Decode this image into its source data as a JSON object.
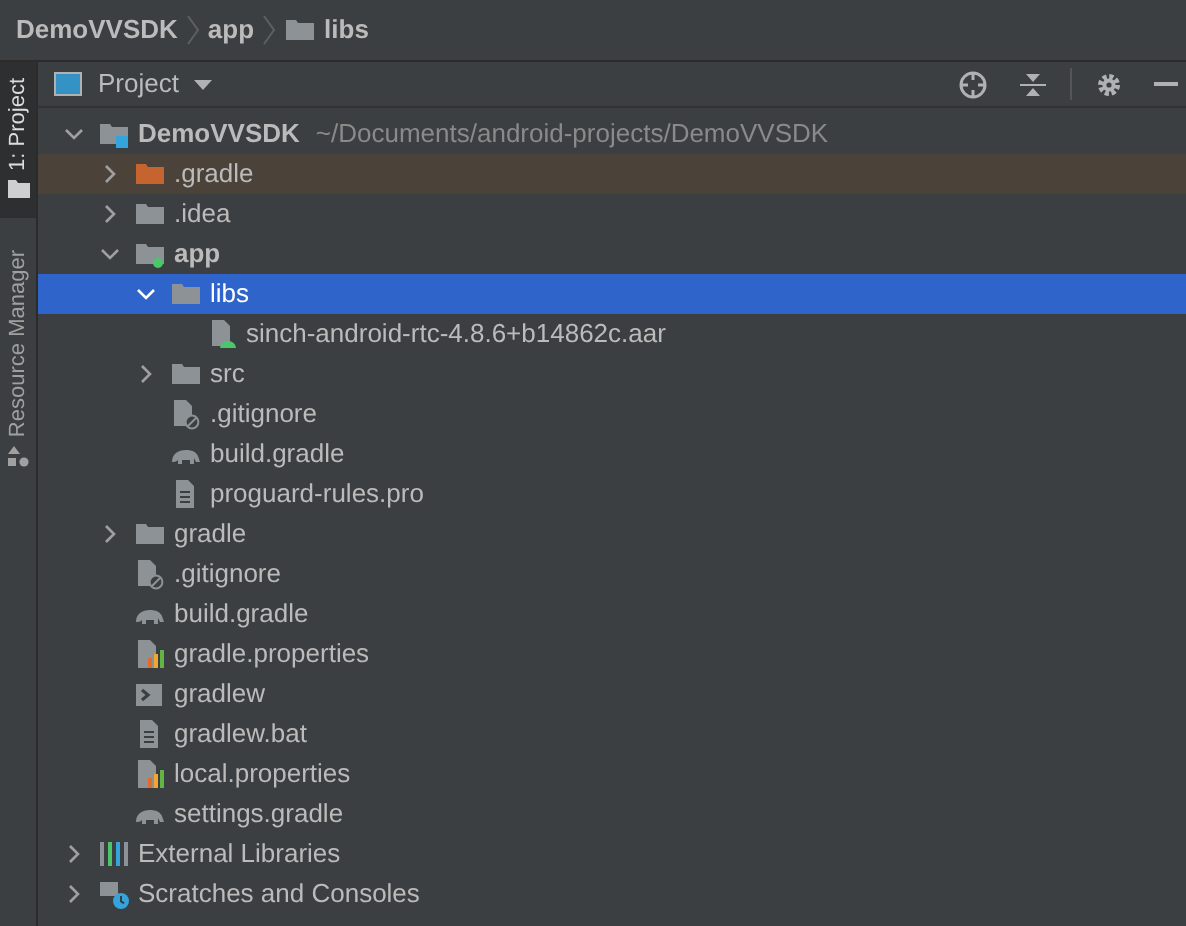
{
  "breadcrumb": [
    "DemoVVSDK",
    "app",
    "libs"
  ],
  "side_tabs": [
    {
      "label": "1: Project",
      "selected": true
    },
    {
      "label": "Resource Manager",
      "selected": false
    }
  ],
  "panel": {
    "title": "Project"
  },
  "tree": [
    {
      "label": "DemoVVSDK",
      "path": "~/Documents/android-projects/DemoVVSDK",
      "kind": "module",
      "expanded": true,
      "selected": false,
      "children": [
        {
          "label": ".gradle",
          "kind": "excluded",
          "expanded": false,
          "selected": false
        },
        {
          "label": ".idea",
          "kind": "folder",
          "expanded": false,
          "selected": false
        },
        {
          "label": "app",
          "kind": "submodule",
          "expanded": true,
          "selected": false,
          "children": [
            {
              "label": "libs",
              "kind": "folder",
              "expanded": true,
              "selected": true,
              "children": [
                {
                  "label": "sinch-android-rtc-4.8.6+b14862c.aar",
                  "kind": "archive",
                  "selected": false
                }
              ]
            },
            {
              "label": "src",
              "kind": "folder",
              "expanded": false,
              "selected": false
            },
            {
              "label": ".gitignore",
              "kind": "ignore",
              "selected": false
            },
            {
              "label": "build.gradle",
              "kind": "gradle",
              "selected": false
            },
            {
              "label": "proguard-rules.pro",
              "kind": "text",
              "selected": false
            }
          ]
        },
        {
          "label": "gradle",
          "kind": "folder",
          "expanded": false,
          "selected": false
        },
        {
          "label": ".gitignore",
          "kind": "ignore",
          "selected": false
        },
        {
          "label": "build.gradle",
          "kind": "gradle",
          "selected": false
        },
        {
          "label": "gradle.properties",
          "kind": "properties",
          "selected": false
        },
        {
          "label": "gradlew",
          "kind": "shell",
          "selected": false
        },
        {
          "label": "gradlew.bat",
          "kind": "text",
          "selected": false
        },
        {
          "label": "local.properties",
          "kind": "properties",
          "selected": false
        },
        {
          "label": "settings.gradle",
          "kind": "gradle",
          "selected": false
        }
      ]
    },
    {
      "label": "External Libraries",
      "kind": "libraries",
      "expanded": false,
      "selected": false
    },
    {
      "label": "Scratches and Consoles",
      "kind": "scratches",
      "expanded": false,
      "selected": false
    }
  ]
}
